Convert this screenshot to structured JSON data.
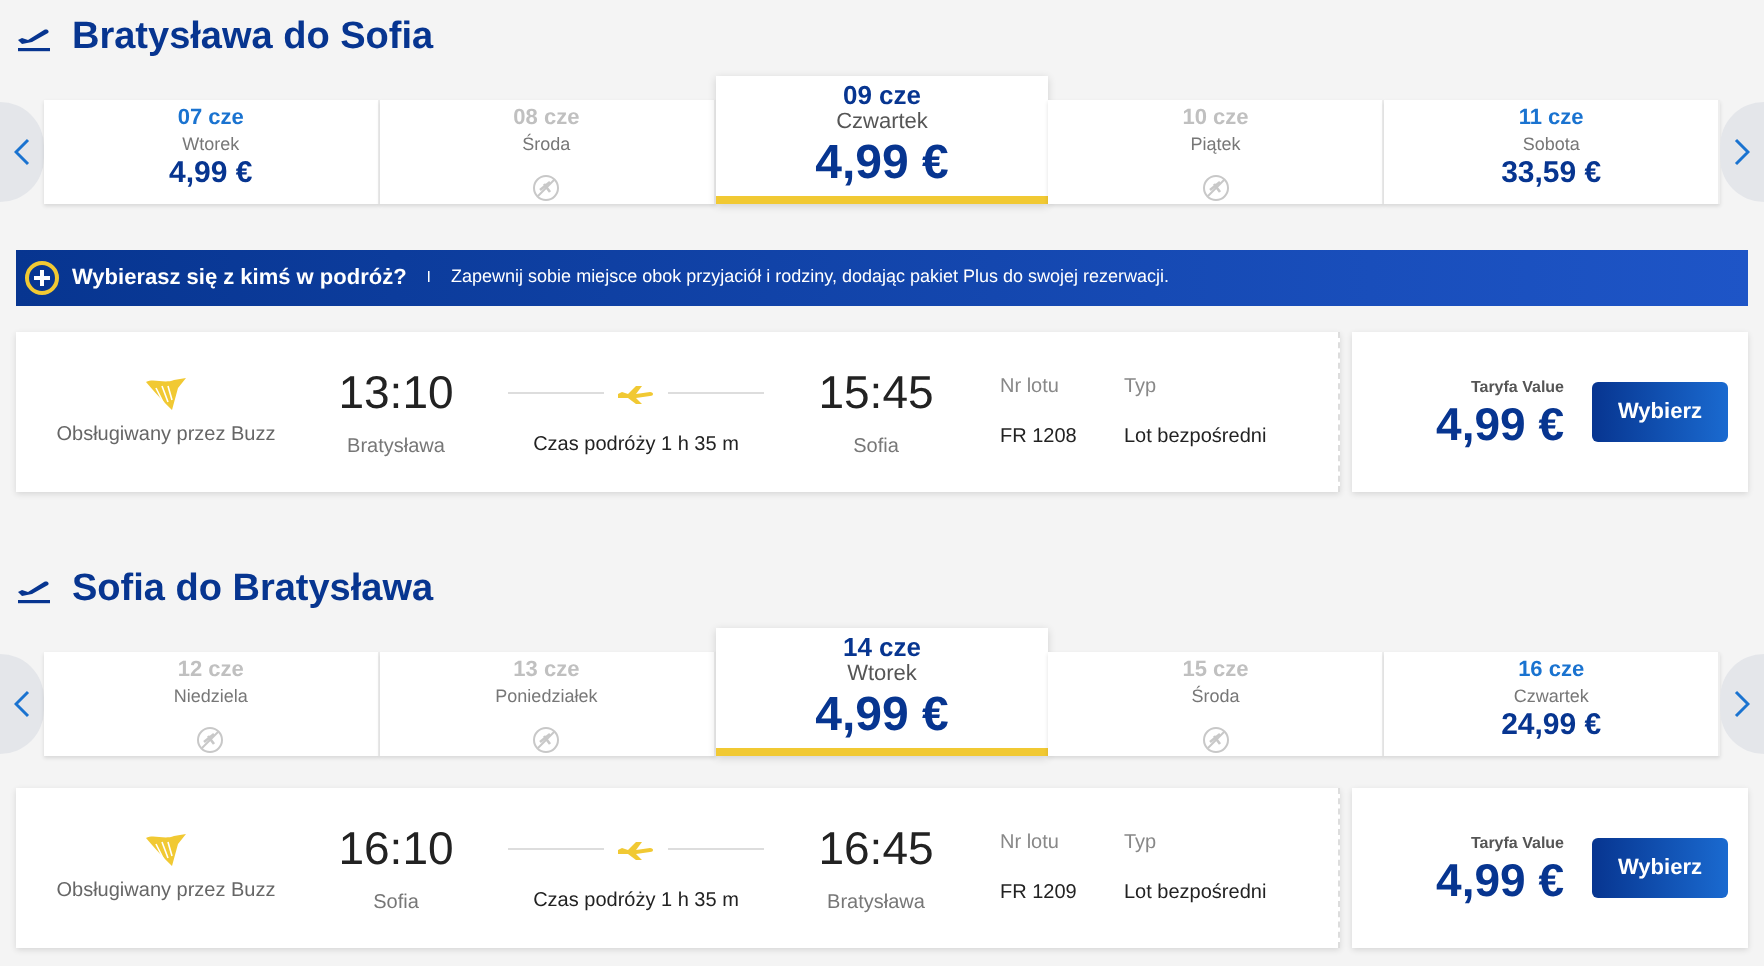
{
  "sections": [
    {
      "title": "Bratysława do Sofia",
      "dates": [
        {
          "date": "07 cze",
          "day": "Wtorek",
          "price": "4,99 €",
          "available": true,
          "selected": false
        },
        {
          "date": "08 cze",
          "day": "Środa",
          "available": false,
          "selected": false
        },
        {
          "date": "09 cze",
          "day": "Czwartek",
          "price": "4,99 €",
          "available": true,
          "selected": true
        },
        {
          "date": "10 cze",
          "day": "Piątek",
          "available": false,
          "selected": false
        },
        {
          "date": "11 cze",
          "day": "Sobota",
          "price": "33,59 €",
          "available": true,
          "selected": false
        }
      ],
      "banner": {
        "title": "Wybierasz się z kimś w podróż?",
        "separator": "I",
        "text": "Zapewnij sobie miejsce obok przyjaciół i rodziny, dodając pakiet Plus do swojej rezerwacji."
      },
      "flight": {
        "operator": "Obsługiwany przez Buzz",
        "depart_time": "13:10",
        "depart_city": "Bratysława",
        "duration": "Czas podróży 1 h 35 m",
        "arrive_time": "15:45",
        "arrive_city": "Sofia",
        "flight_label": "Nr lotu",
        "flight_number": "FR 1208",
        "type_label": "Typ",
        "type": "Lot bezpośredni",
        "fare_label": "Taryfa Value",
        "price": "4,99 €",
        "button": "Wybierz"
      }
    },
    {
      "title": "Sofia do Bratysława",
      "dates": [
        {
          "date": "12 cze",
          "day": "Niedziela",
          "available": false,
          "selected": false
        },
        {
          "date": "13 cze",
          "day": "Poniedziałek",
          "available": false,
          "selected": false
        },
        {
          "date": "14 cze",
          "day": "Wtorek",
          "price": "4,99 €",
          "available": true,
          "selected": true
        },
        {
          "date": "15 cze",
          "day": "Środa",
          "available": false,
          "selected": false
        },
        {
          "date": "16 cze",
          "day": "Czwartek",
          "price": "24,99 €",
          "available": true,
          "selected": false
        }
      ],
      "flight": {
        "operator": "Obsługiwany przez Buzz",
        "depart_time": "16:10",
        "depart_city": "Sofia",
        "duration": "Czas podróży 1 h 35 m",
        "arrive_time": "16:45",
        "arrive_city": "Bratysława",
        "flight_label": "Nr lotu",
        "flight_number": "FR 1209",
        "type_label": "Typ",
        "type": "Lot bezpośredni",
        "fare_label": "Taryfa Value",
        "price": "4,99 €",
        "button": "Wybierz"
      }
    }
  ]
}
